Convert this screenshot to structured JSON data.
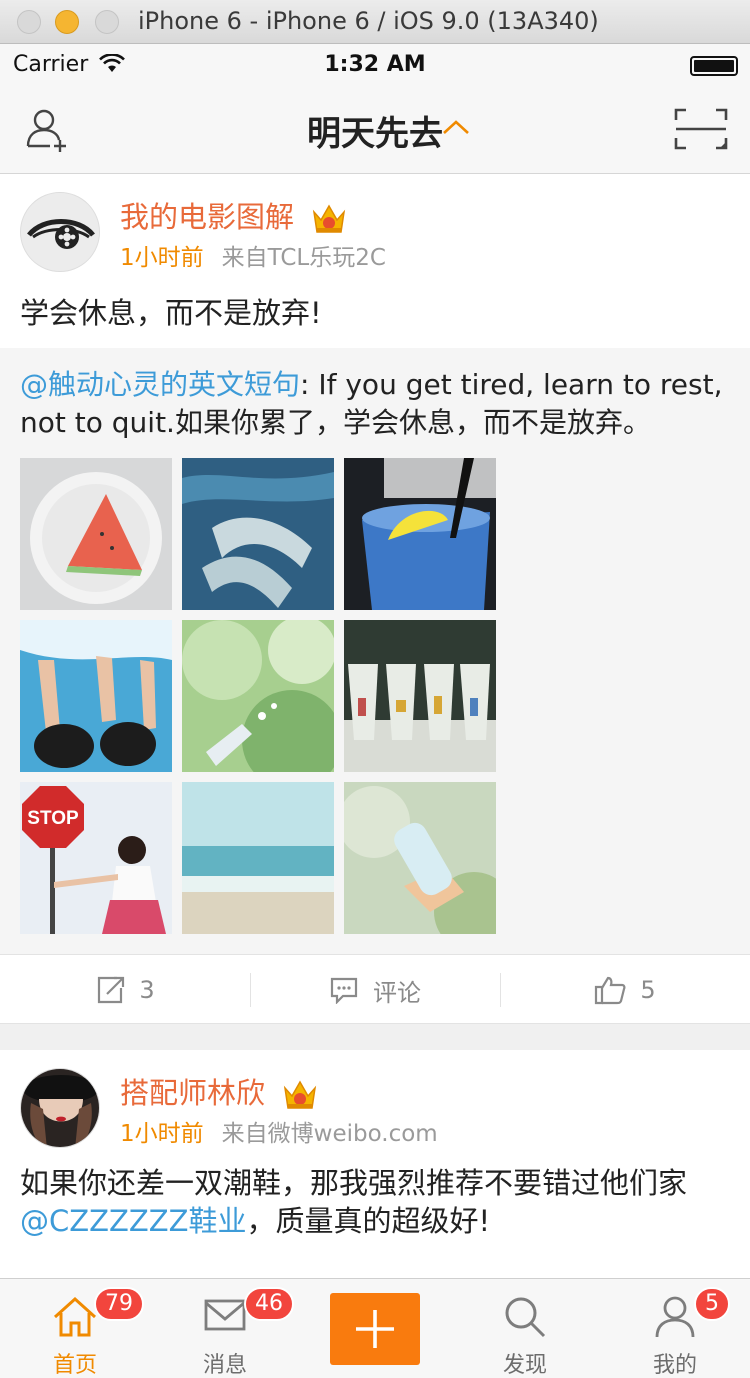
{
  "window": {
    "title": "iPhone 6 - iPhone 6 / iOS 9.0 (13A340)"
  },
  "status_bar": {
    "carrier": "Carrier",
    "time": "1:32 AM"
  },
  "nav": {
    "title": "明天先去"
  },
  "posts": [
    {
      "username": "我的电影图解",
      "time": "1小时前",
      "source": "来自TCL乐玩2C",
      "text": "学会休息，而不是放弃!",
      "repost": {
        "mention": "@触动心灵的英文短句",
        "text": ": If you get tired, learn to rest, not to quit.如果你累了，学会休息，而不是放弃。"
      },
      "actions": {
        "repost_count": "3",
        "comment_label": "评论",
        "like_count": "5"
      }
    },
    {
      "username": "搭配师林欣",
      "time": "1小时前",
      "source": "来自微博weibo.com",
      "text_before": "如果你还差一双潮鞋，那我强烈推荐不要错过他们家",
      "mention": "@CZZZZZZ鞋业",
      "text_after": "，质量真的超级好!"
    }
  ],
  "tabbar": {
    "home": {
      "label": "首页",
      "badge": "79"
    },
    "messages": {
      "label": "消息",
      "badge": "46"
    },
    "discover": {
      "label": "发现"
    },
    "me": {
      "label": "我的",
      "badge": "5"
    }
  },
  "colors": {
    "accent": "#f97b0e",
    "username": "#e86a3a",
    "link": "#3d9bd8",
    "badge": "#f2453d"
  }
}
